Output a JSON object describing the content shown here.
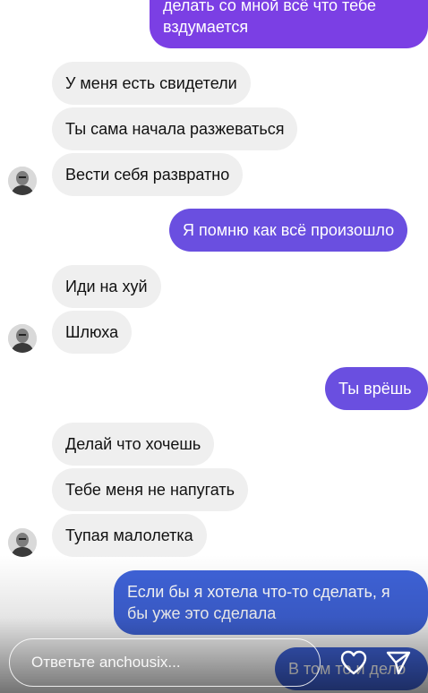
{
  "messages": {
    "out_top": "делать со мной всё что тебе вздумается",
    "m1": "У меня есть свидетели",
    "m2": "Ты сама начала разжеваться",
    "m3": "Вести себя развратно",
    "m4": "Я помню как всё произошло",
    "m5": "Иди на хуй",
    "m6": "Шлюха",
    "m7": "Ты врёшь",
    "m8": "Делай что хочешь",
    "m9": "Тебе меня не напугать",
    "m10": "Тупая малолетка",
    "m11": "Если бы я хотела что-то сделать, я бы уже это сделала",
    "m12": "В том то и дело"
  },
  "reply": {
    "placeholder": "Ответьте anchousix..."
  },
  "icons": {
    "like": "heart-icon",
    "send": "send-icon",
    "avatar": "avatar"
  },
  "colors": {
    "incoming_bubble": "#efefef",
    "outgoing_purple": "#7b3fe4",
    "outgoing_violet": "#6a4fe0",
    "outgoing_blue": "#3f63d9"
  }
}
